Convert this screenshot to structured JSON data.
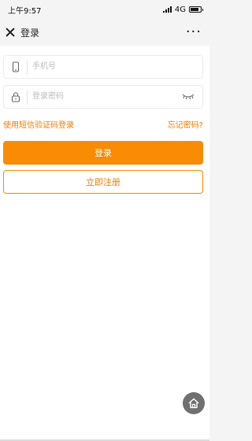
{
  "status_bar": {
    "time": "上午9:57",
    "network": "4G"
  },
  "nav": {
    "title": "登录",
    "close_icon": "close-icon",
    "more_label": "···"
  },
  "form": {
    "phone_placeholder": "手机号",
    "password_placeholder": "登录密码",
    "phone_icon": "phone-icon",
    "lock_icon": "lock-icon",
    "eye_icon": "eye-closed-icon"
  },
  "links": {
    "sms_login": "使用短信验证码登录",
    "forgot_password": "忘记密码?"
  },
  "buttons": {
    "login": "登录",
    "register": "立即注册"
  },
  "floating": {
    "home_icon": "home-icon"
  },
  "colors": {
    "accent": "#f98b05",
    "accent_text": "#f47d04",
    "placeholder": "#bdbdbd"
  }
}
